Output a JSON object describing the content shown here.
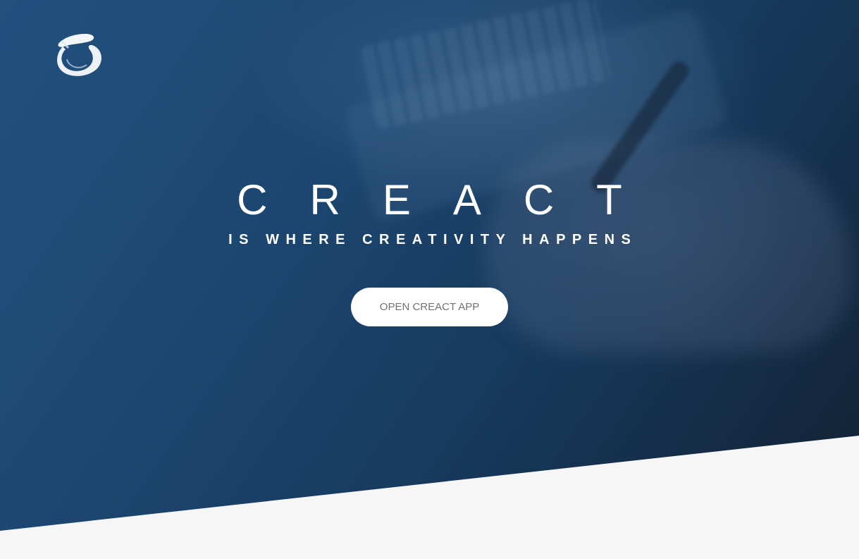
{
  "hero": {
    "title": "CREACT",
    "tagline": "IS WHERE CREATIVITY HAPPENS",
    "cta_label": "OPEN CREACT APP",
    "logo_icon": "brush-circle-logo-icon",
    "colors": {
      "hero_dark": "#142a42",
      "hero_light": "#22517f",
      "page_background": "#f6f6f7",
      "cta_background": "#ffffff",
      "cta_text": "#6f7276"
    }
  }
}
